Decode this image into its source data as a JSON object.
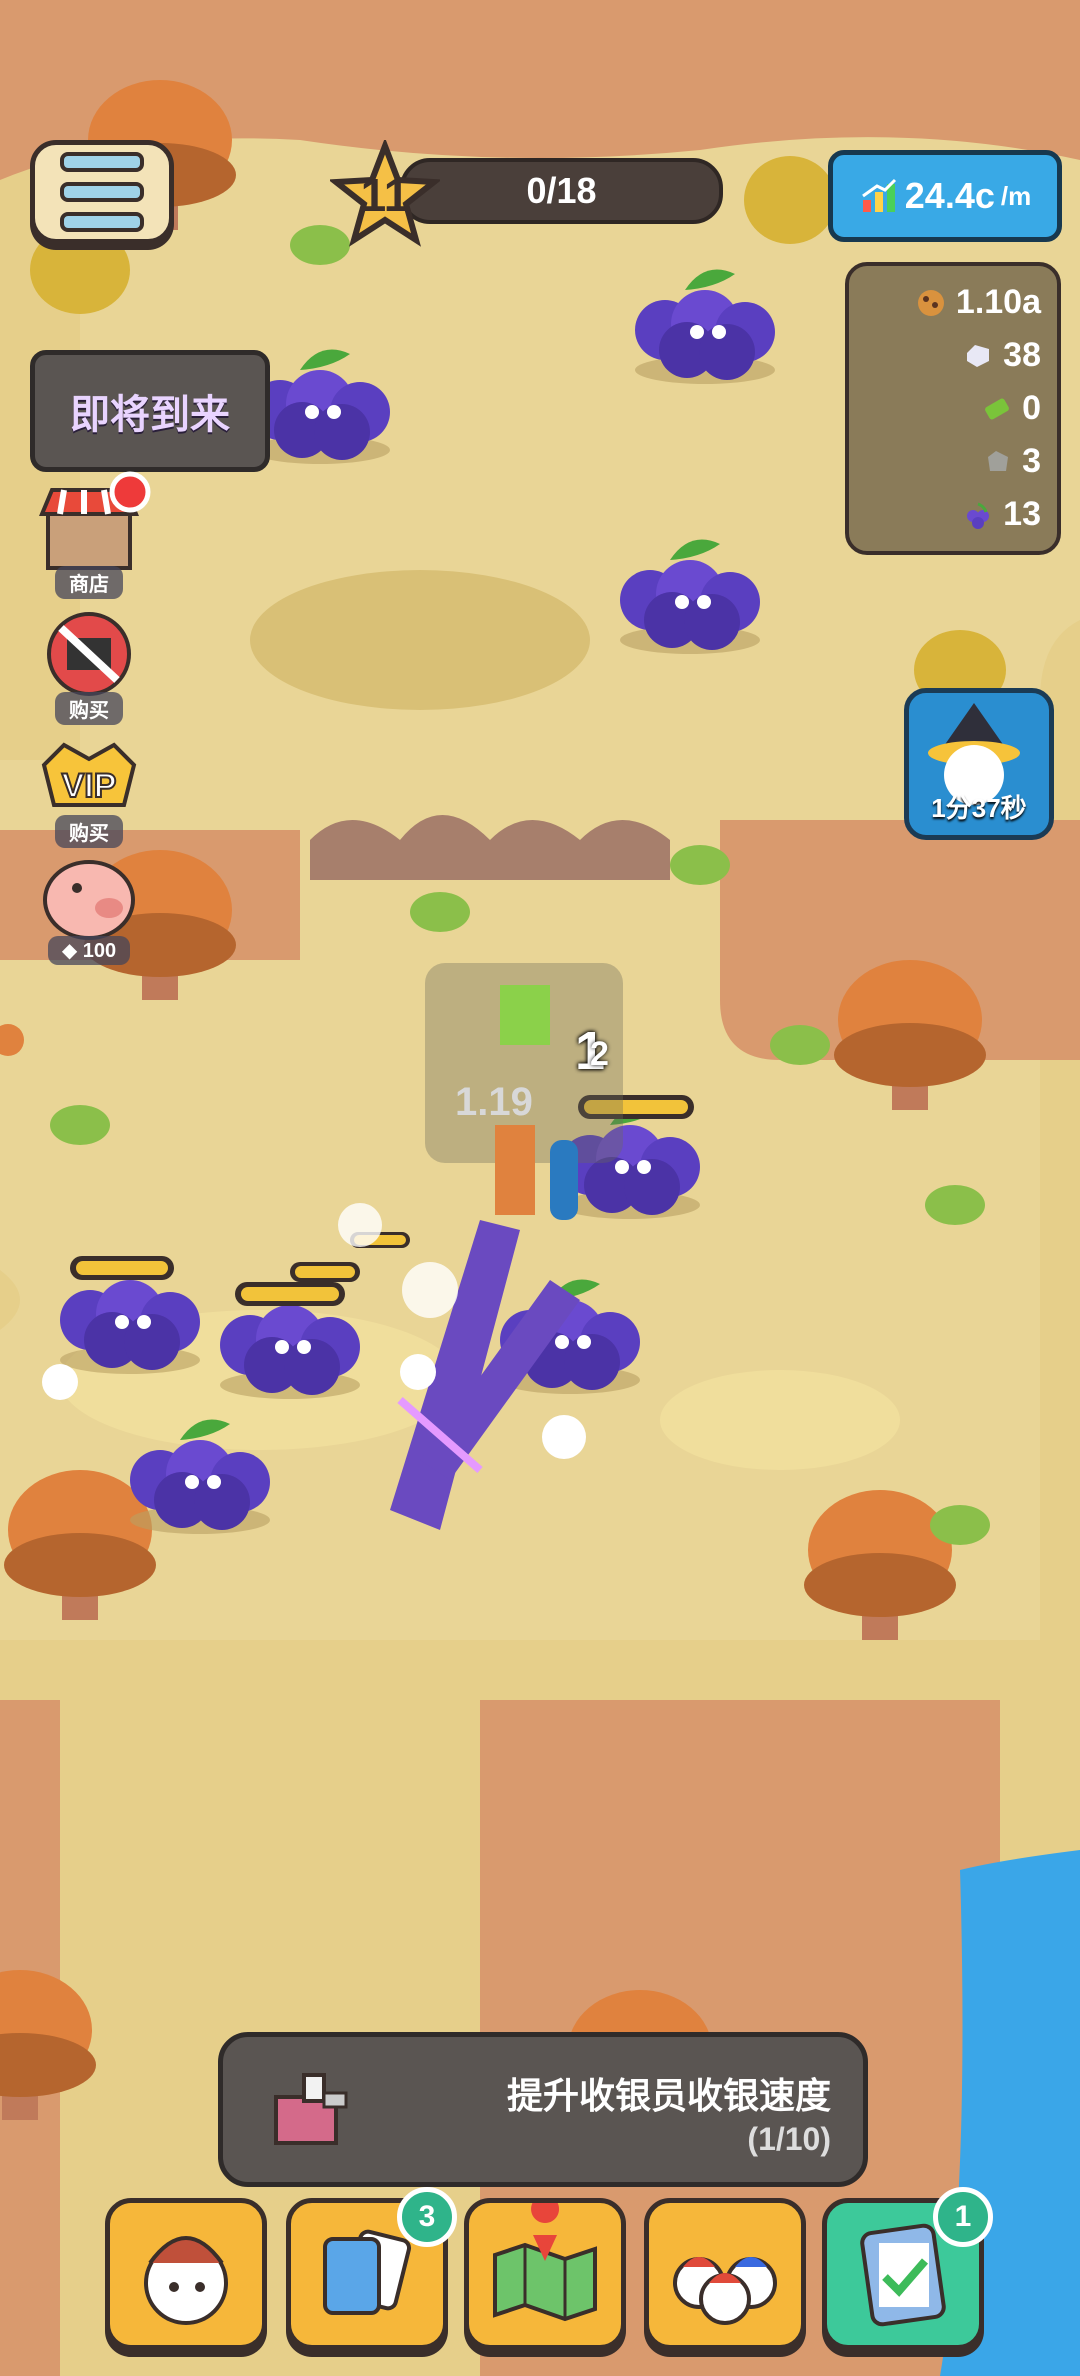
{
  "level": {
    "number": "11",
    "progress": "0/18"
  },
  "rate": {
    "value": "24.4c",
    "unit": "/m"
  },
  "resources": [
    {
      "icon": "cookie-icon",
      "value": "1.10a"
    },
    {
      "icon": "gem-icon",
      "value": "38"
    },
    {
      "icon": "cash-icon",
      "value": "0"
    },
    {
      "icon": "stone-icon",
      "value": "3"
    },
    {
      "icon": "grape-icon",
      "value": "13"
    }
  ],
  "coming_soon": "即将到来",
  "side_buttons": [
    {
      "name": "shop",
      "label": "商店",
      "icon": "shop-icon",
      "has_alert": true
    },
    {
      "name": "no-ads",
      "label": "购买",
      "icon": "no-ads-icon"
    },
    {
      "name": "vip",
      "label": "购买",
      "icon": "vip-icon"
    },
    {
      "name": "piggy-bank",
      "label": "100",
      "icon": "piggy-bank-icon"
    }
  ],
  "timer": {
    "label": "1分37秒"
  },
  "floating": {
    "value_text": "1.19",
    "damage_main": "1",
    "damage_sub": "2"
  },
  "task": {
    "title": "提升收银员收银速度",
    "count": "(1/10)"
  },
  "nav": [
    {
      "name": "characters",
      "icon": "character-icon",
      "badge": ""
    },
    {
      "name": "cards",
      "icon": "cards-icon",
      "badge": "3"
    },
    {
      "name": "map",
      "icon": "map-icon",
      "badge": ""
    },
    {
      "name": "staff",
      "icon": "staff-icon",
      "badge": ""
    },
    {
      "name": "tasks",
      "icon": "clipboard-check-icon",
      "badge": "1"
    }
  ],
  "colors": {
    "ground": "#e8d08c",
    "cliff": "#d99a6e",
    "grape": "#5a3fc0",
    "water": "#3aa6e8",
    "accent": "#39a9e6"
  }
}
